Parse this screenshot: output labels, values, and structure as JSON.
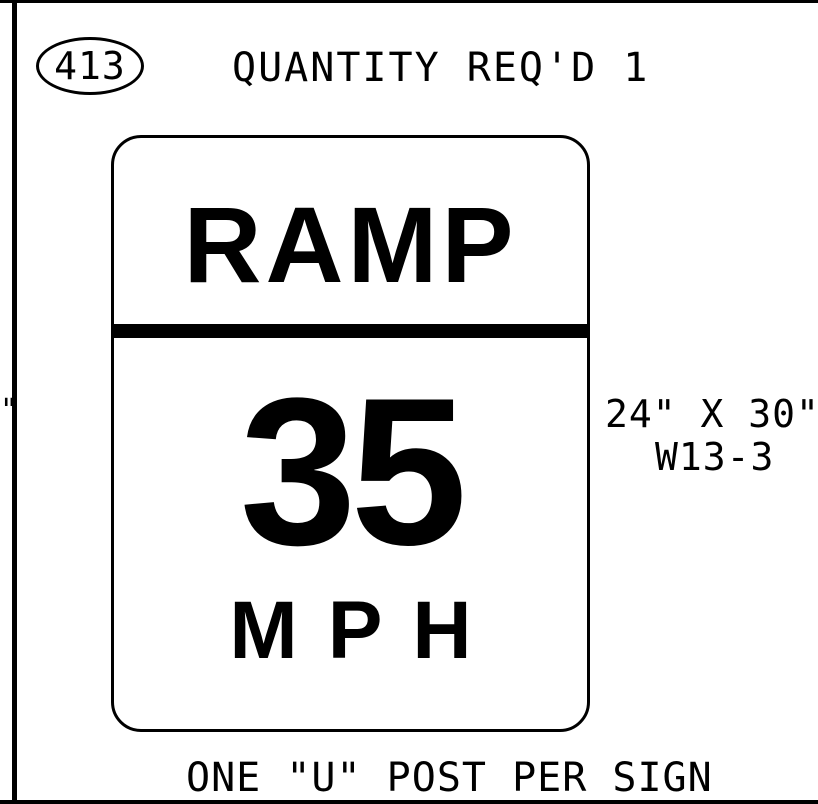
{
  "header": {
    "sign_number": "413",
    "quantity_text": "QUANTITY REQ'D 1"
  },
  "sign": {
    "top_text": "RAMP",
    "speed": "35",
    "unit": "MPH"
  },
  "specs": {
    "size": "24\" X 30\"",
    "code": "W13-3"
  },
  "footer": {
    "post_note": "ONE \"U\" POST PER SIGN"
  },
  "left_margin_mark": "\""
}
